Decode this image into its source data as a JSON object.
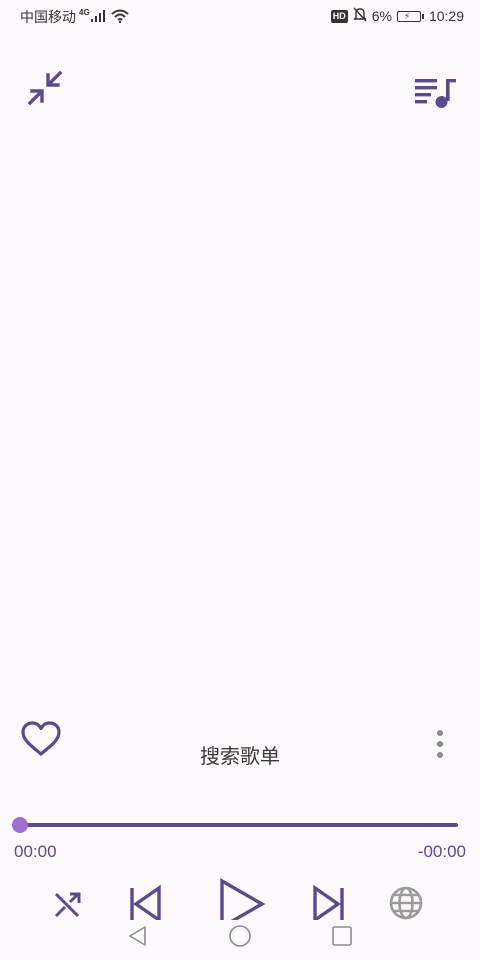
{
  "status_bar": {
    "carrier": "中国移动",
    "network": "4G",
    "hd_badge": "HD",
    "battery_percent": "6%",
    "time": "10:29"
  },
  "header": {
    "collapse_icon": "collapse-arrows-icon",
    "queue_icon": "playlist-music-icon"
  },
  "track": {
    "title": "搜索歌单",
    "favorite_icon": "heart-outline-icon",
    "more_icon": "more-vertical-icon"
  },
  "progress": {
    "elapsed": "00:00",
    "remaining": "-00:00",
    "fraction": 0
  },
  "controls": {
    "shuffle_icon": "shuffle-icon",
    "prev_icon": "skip-previous-icon",
    "play_icon": "play-icon",
    "next_icon": "skip-next-icon",
    "globe_icon": "globe-icon"
  },
  "nav": {
    "back_icon": "back-triangle-icon",
    "home_icon": "home-circle-icon",
    "recent_icon": "recent-square-icon"
  },
  "colors": {
    "accent": "#5c4a8a",
    "thumb": "#a070d0",
    "background": "#fdf9fc"
  }
}
